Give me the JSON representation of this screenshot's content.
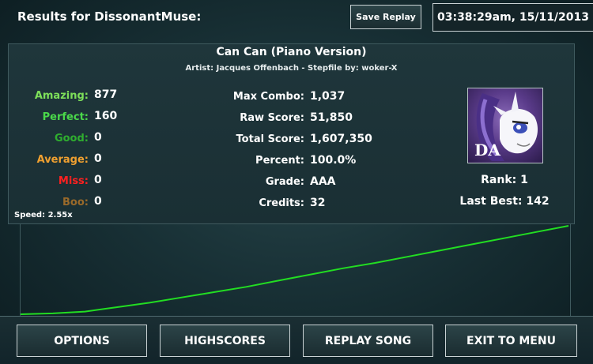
{
  "header": {
    "title": "Results for DissonantMuse:",
    "save_replay_label": "Save Replay",
    "datetime": "03:38:29am, 15/11/2013"
  },
  "song": {
    "title": "Can Can (Piano Version)",
    "artist_line": "Artist: Jacques Offenbach  -  Stepfile by: woker-X"
  },
  "judgements": [
    {
      "label": "Amazing:",
      "value": "877",
      "color": "#7ee05a"
    },
    {
      "label": "Perfect:",
      "value": "160",
      "color": "#4ad84a"
    },
    {
      "label": "Good:",
      "value": "0",
      "color": "#2fae2f"
    },
    {
      "label": "Average:",
      "value": "0",
      "color": "#f0a030"
    },
    {
      "label": "Miss:",
      "value": "0",
      "color": "#ff2020"
    },
    {
      "label": "Boo:",
      "value": "0",
      "color": "#9a6a2a"
    }
  ],
  "stats": [
    {
      "label": "Max Combo:",
      "value": "1,037"
    },
    {
      "label": "Raw Score:",
      "value": "51,850"
    },
    {
      "label": "Total Score:",
      "value": "1,607,350"
    },
    {
      "label": "Percent:",
      "value": "100.0%"
    },
    {
      "label": "Grade:",
      "value": "AAA"
    },
    {
      "label": "Credits:",
      "value": "32"
    }
  ],
  "speed": "Speed: 2.55x",
  "rank": "Rank: 1",
  "last_best": "Last Best: 142",
  "avatar_logo": "DA",
  "graph": {
    "line_color": "#22dd22",
    "points": [
      0,
      0.01,
      0.03,
      0.08,
      0.13,
      0.19,
      0.25,
      0.31,
      0.38,
      0.45,
      0.52,
      0.58,
      0.65,
      0.72,
      0.79,
      0.86,
      0.93,
      1.0
    ]
  },
  "buttons": {
    "options": "OPTIONS",
    "highscores": "HIGHSCORES",
    "replay_song": "REPLAY SONG",
    "exit_to_menu": "EXIT TO MENU"
  }
}
